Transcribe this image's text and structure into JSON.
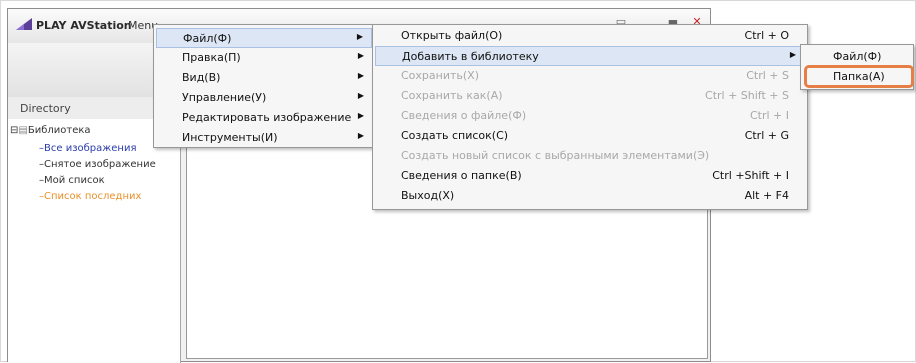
{
  "window": {
    "app_title": "PLAY AVStation",
    "menu_label": "Menu",
    "minimize_glyph": "▭",
    "maximize_glyph": "▬",
    "close_glyph": "✕"
  },
  "directory": {
    "header": "Directory",
    "root": "Библиотека",
    "items": [
      "Все изображения",
      "Снятое изображение",
      "Мой список",
      "Список последних"
    ]
  },
  "menu_main": {
    "items": [
      {
        "label": "Файл(Ф)"
      },
      {
        "label": "Правка(П)"
      },
      {
        "label": "Вид(В)"
      },
      {
        "label": "Управление(У)"
      },
      {
        "label": "Редактировать изображение"
      },
      {
        "label": "Инструменты(И)"
      }
    ]
  },
  "menu_file": {
    "items": [
      {
        "label": "Открыть файл(О)",
        "shortcut": "Ctrl + O"
      },
      {
        "label": "Добавить в библиотеку",
        "shortcut": ""
      },
      {
        "label": "Сохранить(Х)",
        "shortcut": "Ctrl + S"
      },
      {
        "label": "Сохранить как(А)",
        "shortcut": "Ctrl + Shift + S"
      },
      {
        "label": "Сведения о файле(Ф)",
        "shortcut": "Ctrl + I"
      },
      {
        "label": "Создать список(С)",
        "shortcut": "Ctrl + G"
      },
      {
        "label": "Создать новый список с выбранными элементами(Э)",
        "shortcut": ""
      },
      {
        "label": "Сведения о папке(В)",
        "shortcut": "Ctrl +Shift + I"
      },
      {
        "label": "Выход(Х)",
        "shortcut": "Alt + F4"
      }
    ]
  },
  "menu_add_library": {
    "items": [
      {
        "label": "Файл(Ф)"
      },
      {
        "label": "Папка(А)"
      }
    ]
  },
  "colors": {
    "highlight": "#e57f45",
    "selected_tree_item": "#2a3caa",
    "recent_tree_item": "#e8902a"
  }
}
